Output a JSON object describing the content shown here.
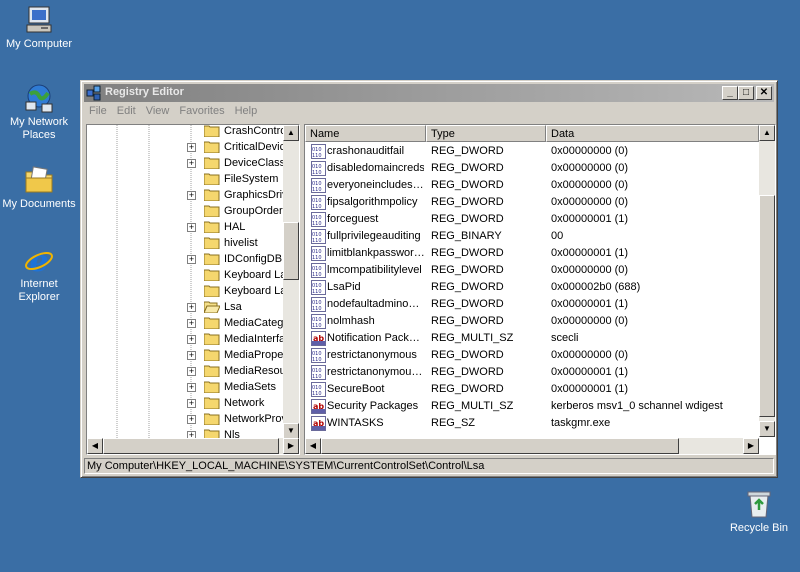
{
  "desktop": {
    "icons": [
      {
        "label": "My Computer",
        "icon": "my-computer-icon"
      },
      {
        "label": "My Network Places",
        "icon": "network-places-icon"
      },
      {
        "label": "My Documents",
        "icon": "my-documents-icon"
      },
      {
        "label": "Internet Explorer",
        "icon": "internet-explorer-icon"
      },
      {
        "label": "Recycle Bin",
        "icon": "recycle-bin-icon"
      }
    ]
  },
  "window": {
    "title": "Registry Editor",
    "buttons": {
      "minimize": "_",
      "maximize": "□",
      "close": "✕"
    }
  },
  "menu": [
    "File",
    "Edit",
    "View",
    "Favorites",
    "Help"
  ],
  "tree": {
    "items": [
      {
        "label": "CrashControl",
        "expander": "",
        "open": false
      },
      {
        "label": "CriticalDeviceDatabase",
        "expander": "+",
        "open": false
      },
      {
        "label": "DeviceClasses",
        "expander": "+",
        "open": false
      },
      {
        "label": "FileSystem",
        "expander": "",
        "open": false
      },
      {
        "label": "GraphicsDrivers",
        "expander": "+",
        "open": false
      },
      {
        "label": "GroupOrderList",
        "expander": "",
        "open": false
      },
      {
        "label": "HAL",
        "expander": "+",
        "open": false
      },
      {
        "label": "hivelist",
        "expander": "",
        "open": false
      },
      {
        "label": "IDConfigDB",
        "expander": "+",
        "open": false
      },
      {
        "label": "Keyboard Layout",
        "expander": "",
        "open": false
      },
      {
        "label": "Keyboard Layouts",
        "expander": "",
        "open": false
      },
      {
        "label": "Lsa",
        "expander": "+",
        "open": true
      },
      {
        "label": "MediaCategories",
        "expander": "+",
        "open": false
      },
      {
        "label": "MediaInterfaces",
        "expander": "+",
        "open": false
      },
      {
        "label": "MediaProperties",
        "expander": "+",
        "open": false
      },
      {
        "label": "MediaResources",
        "expander": "+",
        "open": false
      },
      {
        "label": "MediaSets",
        "expander": "+",
        "open": false
      },
      {
        "label": "Network",
        "expander": "+",
        "open": false
      },
      {
        "label": "NetworkProvider",
        "expander": "+",
        "open": false
      },
      {
        "label": "Nls",
        "expander": "+",
        "open": false
      }
    ]
  },
  "list": {
    "columns": [
      "Name",
      "Type",
      "Data"
    ],
    "rows": [
      {
        "name": "crashonauditfail",
        "type": "REG_DWORD",
        "data": "0x00000000 (0)",
        "icon": "dword-value-icon"
      },
      {
        "name": "disabledomaincreds",
        "type": "REG_DWORD",
        "data": "0x00000000 (0)",
        "icon": "dword-value-icon"
      },
      {
        "name": "everyoneincludes…",
        "type": "REG_DWORD",
        "data": "0x00000000 (0)",
        "icon": "dword-value-icon"
      },
      {
        "name": "fipsalgorithmpolicy",
        "type": "REG_DWORD",
        "data": "0x00000000 (0)",
        "icon": "dword-value-icon"
      },
      {
        "name": "forceguest",
        "type": "REG_DWORD",
        "data": "0x00000001 (1)",
        "icon": "dword-value-icon"
      },
      {
        "name": "fullprivilegeauditing",
        "type": "REG_BINARY",
        "data": "00",
        "icon": "binary-value-icon"
      },
      {
        "name": "limitblankpasswor…",
        "type": "REG_DWORD",
        "data": "0x00000001 (1)",
        "icon": "dword-value-icon"
      },
      {
        "name": "lmcompatibilitylevel",
        "type": "REG_DWORD",
        "data": "0x00000000 (0)",
        "icon": "dword-value-icon"
      },
      {
        "name": "LsaPid",
        "type": "REG_DWORD",
        "data": "0x000002b0 (688)",
        "icon": "dword-value-icon"
      },
      {
        "name": "nodefaultadmino…",
        "type": "REG_DWORD",
        "data": "0x00000001 (1)",
        "icon": "dword-value-icon"
      },
      {
        "name": "nolmhash",
        "type": "REG_DWORD",
        "data": "0x00000000 (0)",
        "icon": "dword-value-icon"
      },
      {
        "name": "Notification Pack…",
        "type": "REG_MULTI_SZ",
        "data": "scecli",
        "icon": "string-value-icon"
      },
      {
        "name": "restrictanonymous",
        "type": "REG_DWORD",
        "data": "0x00000000 (0)",
        "icon": "dword-value-icon"
      },
      {
        "name": "restrictanonymou…",
        "type": "REG_DWORD",
        "data": "0x00000001 (1)",
        "icon": "dword-value-icon"
      },
      {
        "name": "SecureBoot",
        "type": "REG_DWORD",
        "data": "0x00000001 (1)",
        "icon": "dword-value-icon"
      },
      {
        "name": "Security Packages",
        "type": "REG_MULTI_SZ",
        "data": "kerberos msv1_0 schannel wdigest",
        "icon": "string-value-icon"
      },
      {
        "name": "WINTASKS",
        "type": "REG_SZ",
        "data": "taskgmr.exe",
        "icon": "string-value-icon"
      }
    ]
  },
  "status_bar": "My Computer\\HKEY_LOCAL_MACHINE\\SYSTEM\\CurrentControlSet\\Control\\Lsa",
  "colors": {
    "desktop": "#3a6ea5",
    "titlebar_inactive": "#808080",
    "face": "#d4d0c8"
  }
}
